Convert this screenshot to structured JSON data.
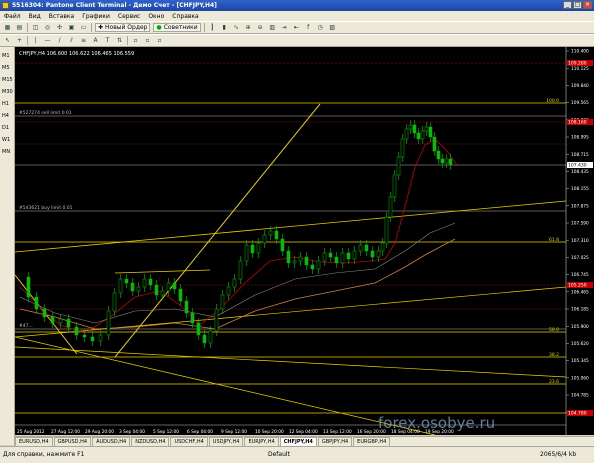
{
  "app": {
    "title": "5516304: Pantone Client Terminal - Демо Счет - [CHFJPY,H4]"
  },
  "menu": [
    "Файл",
    "Вид",
    "Вставка",
    "Графики",
    "Сервис",
    "Окно",
    "Справка"
  ],
  "toolbar": {
    "new_order": "Новый Ордер",
    "advisors": "Советники"
  },
  "timeframes": [
    "M1",
    "M5",
    "M15",
    "M30",
    "H1",
    "H4",
    "D1",
    "W1",
    "MN"
  ],
  "chart": {
    "info": "CHFJPY,H4  106.600 106.622 106.465 106.559",
    "labels": {
      "sell_limit": "#527274 sell limit 0.01",
      "buy_limit": "#543621 buy limit 0.01",
      "left_label": "#47..."
    },
    "price_ticks": [
      "110.400",
      "110.125",
      "109.840",
      "109.565",
      "109.280",
      "108.995",
      "108.715",
      "108.435",
      "108.155",
      "107.875",
      "107.590",
      "107.310",
      "107.025",
      "106.745",
      "106.465",
      "106.185",
      "105.900",
      "105.620",
      "105.345",
      "105.060",
      "104.785",
      "104.500"
    ],
    "fib_labels": [
      "100.0",
      "61.8",
      "50.0",
      "38.2",
      "23.6"
    ],
    "right_tags": [
      "109.280",
      "108.160",
      "107.430",
      "105.250",
      "104.780"
    ],
    "time_labels": [
      "25 Aug 2012",
      "27 Aug 12:00",
      "29 Aug 20:00",
      "3 Sep 04:00",
      "5 Sep 12:00",
      "6 Sep 04:00",
      "9 Sep 12:00",
      "10 Sep 20:00",
      "12 Sep 04:00",
      "13 Sep 12:00",
      "16 Sep 20:00",
      "18 Sep 04:00",
      "19 Sep 20:00"
    ]
  },
  "tabs": [
    "EURUSD,H4",
    "GBPUSD,H4",
    "AUDUSD,H4",
    "NZDUSD,H4",
    "USDCHF,H4",
    "USDJPY,H4",
    "EURJPY,H4",
    "CHFJPY,H4",
    "GBPJPY,H4",
    "EURGBP,H4"
  ],
  "active_tab": 7,
  "status": {
    "help": "Для справки, нажмите F1",
    "profile": "Default",
    "traffic": "2065/6/4 kb"
  },
  "watermark": "forex.osobye.ru",
  "colors": {
    "candle": "#00c000",
    "ma_red": "#c00000",
    "ma_orange": "#d08040",
    "level": "#e8d000",
    "dashed_red": "#c00000"
  }
}
